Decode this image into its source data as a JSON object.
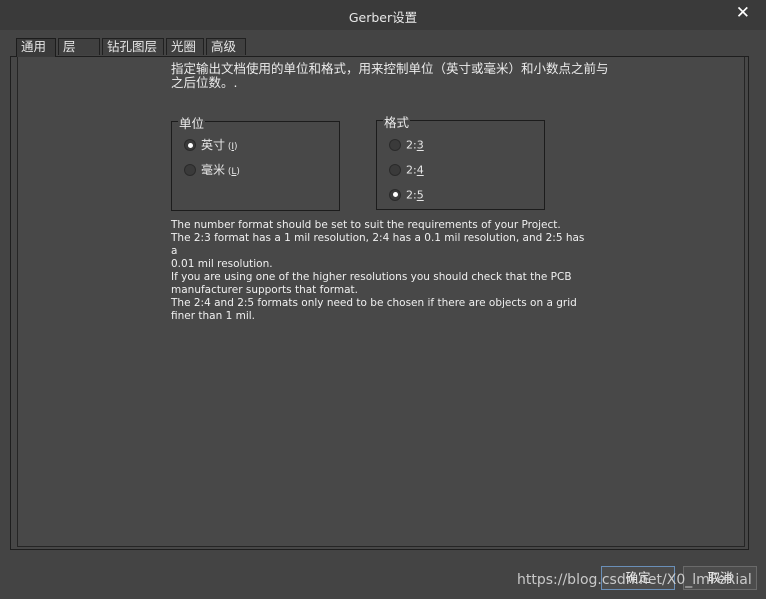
{
  "window": {
    "title": "Gerber设置",
    "close_glyph": "✕"
  },
  "tabs": [
    {
      "label": "通用",
      "active": true
    },
    {
      "label": "层",
      "active": false
    },
    {
      "label": "钻孔图层",
      "active": false
    },
    {
      "label": "光圈",
      "active": false
    },
    {
      "label": "高级",
      "active": false
    }
  ],
  "description": "指定输出文档使用的单位和格式，用来控制单位（英寸或毫米）和小数点之前与之后位数。.",
  "units": {
    "legend": "单位",
    "options": [
      {
        "label": "英寸",
        "accel": "I",
        "checked": true
      },
      {
        "label": "毫米",
        "accel": "L",
        "checked": false
      }
    ]
  },
  "format": {
    "legend": "格式",
    "options": [
      {
        "label_prefix": "2:",
        "accel": "3",
        "checked": false
      },
      {
        "label_prefix": "2:",
        "accel": "4",
        "checked": false
      },
      {
        "label_prefix": "2:",
        "accel": "5",
        "checked": true
      }
    ]
  },
  "notes": [
    "The number format should be set to suit the requirements of your Project.",
    "The 2:3 format has a 1 mil resolution, 2:4 has a 0.1 mil resolution, and 2:5 has a",
    "0.01 mil resolution.",
    "If you are using one of the higher resolutions you should check that the PCB",
    "manufacturer supports that format.",
    "The 2:4 and 2:5 formats only need to be chosen if there are objects on a grid",
    "finer than 1 mil."
  ],
  "buttons": {
    "ok": "确定",
    "cancel": "取消"
  },
  "watermark": "https://blog.csdn.net/X0_lmFeRial"
}
